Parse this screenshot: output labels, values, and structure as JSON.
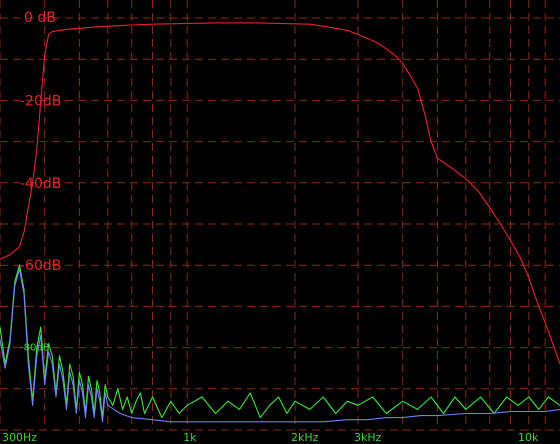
{
  "chart_data": {
    "type": "line",
    "title": "",
    "xlabel": "",
    "ylabel": "",
    "x_scale": "log",
    "xlim_hz": [
      300,
      11000
    ],
    "ylim_db": [
      -100,
      0
    ],
    "grid": true,
    "x_tick_labels": [
      {
        "label": "300Hz",
        "value": 300
      },
      {
        "label": "1k",
        "value": 1000
      },
      {
        "label": "2kHz",
        "value": 2000
      },
      {
        "label": "3kHz",
        "value": 3000
      },
      {
        "label": "10k",
        "value": 10000
      }
    ],
    "y_tick_labels": [
      {
        "label": "0 dB",
        "value": 0,
        "color": "#e8222a"
      },
      {
        "label": "-20dB",
        "value": -20,
        "color": "#e8222a"
      },
      {
        "label": "-40dB",
        "value": -40,
        "color": "#e8222a"
      },
      {
        "label": "-60dB",
        "value": -60,
        "color": "#e8222a"
      },
      {
        "label": "-80dB",
        "value": -80,
        "color": "#39d839"
      }
    ],
    "series": [
      {
        "color": "#e8222a",
        "x": [
          300,
          320,
          330,
          340,
          350,
          360,
          370,
          380,
          390,
          400,
          410,
          420,
          440,
          470,
          500,
          550,
          600,
          700,
          800,
          900,
          1000,
          1200,
          1400,
          1600,
          1800,
          2000,
          2200,
          2400,
          2600,
          2800,
          3000,
          3200,
          3400,
          3600,
          3800,
          4000,
          4200,
          4400,
          4600,
          4800,
          5000,
          5500,
          6000,
          6500,
          7000,
          7500,
          8000,
          8500,
          9000,
          9500,
          10000,
          10500,
          11000
        ],
        "y": [
          -58.5,
          -57.5,
          -56.5,
          -55.5,
          -52,
          -46,
          -40,
          -32,
          -20,
          -9,
          -4,
          -3.3,
          -3,
          -2.7,
          -2.5,
          -2.2,
          -2,
          -1.7,
          -1.5,
          -1.4,
          -1.3,
          -1.2,
          -1.2,
          -1.2,
          -1.3,
          -1.4,
          -1.5,
          -2,
          -2.5,
          -3,
          -4,
          -5,
          -6,
          -7.5,
          -9,
          -11,
          -14,
          -17,
          -23,
          -30,
          -34,
          -36.5,
          -39,
          -42,
          -46,
          -50,
          -54,
          -58,
          -63,
          -69,
          -74,
          -79,
          -84
        ]
      },
      {
        "color": "#39e639",
        "x": [
          300,
          310,
          320,
          330,
          340,
          350,
          360,
          370,
          380,
          390,
          400,
          410,
          420,
          430,
          440,
          450,
          460,
          470,
          480,
          490,
          500,
          510,
          520,
          530,
          540,
          550,
          560,
          570,
          580,
          590,
          600,
          620,
          640,
          660,
          680,
          700,
          720,
          740,
          760,
          780,
          800,
          850,
          900,
          950,
          1000,
          1100,
          1200,
          1300,
          1400,
          1500,
          1600,
          1700,
          1800,
          1900,
          2000,
          2200,
          2400,
          2600,
          2800,
          3000,
          3300,
          3600,
          4000,
          4400,
          4800,
          5200,
          5600,
          6000,
          6600,
          7200,
          7800,
          8400,
          9000,
          9600,
          10200,
          11000
        ],
        "y": [
          -75,
          -84,
          -78,
          -64,
          -60,
          -66,
          -82,
          -93,
          -80,
          -75,
          -88,
          -79,
          -82,
          -91,
          -82,
          -86,
          -94,
          -84,
          -87,
          -95,
          -86,
          -89,
          -96,
          -87,
          -90,
          -96,
          -88,
          -91,
          -97,
          -89,
          -92,
          -94,
          -90,
          -95,
          -92,
          -96,
          -93,
          -91,
          -96,
          -94,
          -92,
          -97,
          -93,
          -96,
          -94,
          -92,
          -96,
          -93,
          -95,
          -91,
          -97,
          -94,
          -92,
          -96,
          -93,
          -95,
          -92,
          -96,
          -93,
          -94,
          -92,
          -96,
          -93,
          -95,
          -92,
          -96,
          -92,
          -95,
          -92,
          -96,
          -92,
          -94,
          -92,
          -95,
          -92,
          -94
        ]
      },
      {
        "color": "#6e7ff5",
        "x": [
          300,
          310,
          320,
          330,
          340,
          350,
          360,
          370,
          380,
          390,
          400,
          410,
          420,
          430,
          440,
          450,
          460,
          470,
          480,
          490,
          500,
          510,
          520,
          530,
          540,
          550,
          560,
          570,
          580,
          590,
          600,
          650,
          700,
          800,
          900,
          1000,
          1200,
          1400,
          1700,
          2000,
          2400,
          2800,
          3200,
          3600,
          4000,
          4500,
          5000,
          6000,
          7000,
          8000,
          9000,
          10000,
          11000
        ],
        "y": [
          -78,
          -85,
          -79,
          -65,
          -61,
          -67,
          -84,
          -94,
          -82,
          -77,
          -89,
          -81,
          -84,
          -92,
          -84,
          -88,
          -95,
          -86,
          -89,
          -96,
          -88,
          -91,
          -97,
          -89,
          -92,
          -97,
          -90,
          -93,
          -98,
          -91,
          -94,
          -96,
          -97,
          -97.5,
          -98,
          -98,
          -98,
          -98,
          -98,
          -98,
          -98,
          -97.5,
          -97.5,
          -97,
          -97,
          -96.5,
          -96.5,
          -96,
          -96,
          -95.5,
          -95.5,
          -95.5,
          -95
        ]
      }
    ]
  }
}
